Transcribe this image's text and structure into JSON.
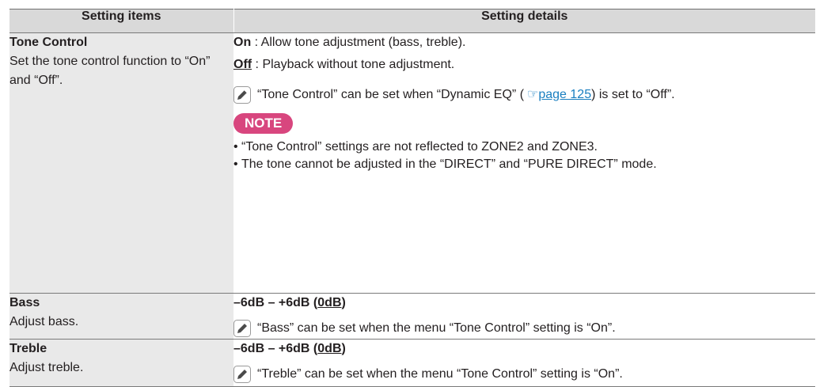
{
  "header": {
    "col1": "Setting items",
    "col2": "Setting details"
  },
  "tone_control": {
    "title": "Tone Control",
    "desc": "Set the tone control function to “On” and “Off”.",
    "on_key": "On",
    "on_text": " : Allow tone adjustment (bass, treble).",
    "off_key": "Off",
    "off_text": " : Playback without tone adjustment.",
    "note_pre": "“Tone Control” can be set when “Dynamic EQ” (",
    "note_link": "page 125",
    "note_post": ") is set to “Off”.",
    "note_badge": "NOTE",
    "notes": [
      "“Tone Control” settings are not reflected to ZONE2 and ZONE3.",
      "The tone cannot be adjusted in the “DIRECT” and “PURE DIRECT” mode."
    ]
  },
  "bass": {
    "title": "Bass",
    "desc": "Adjust bass.",
    "range_pre": "–6dB – +6dB (",
    "range_default": "0dB",
    "range_post": ")",
    "note": "“Bass” can be set when the menu “Tone Control” setting is “On”."
  },
  "treble": {
    "title": "Treble",
    "desc": "Adjust treble.",
    "range_pre": "–6dB – +6dB (",
    "range_default": "0dB",
    "range_post": ")",
    "note": "“Treble” can be set when the menu “Tone Control” setting is “On”."
  },
  "colors": {
    "header_bg": "#d9d9d9",
    "label_bg": "#e9e9e9",
    "note_badge": "#d8467e",
    "link": "#1a7fc0"
  },
  "icons": {
    "note": "pencil-icon",
    "reference": "reference-hand-icon"
  }
}
